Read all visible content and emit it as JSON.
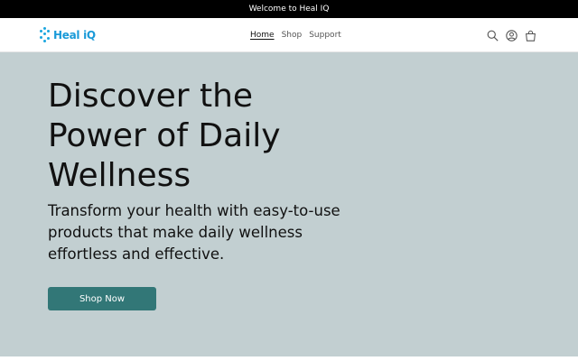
{
  "announcement": {
    "text": "Welcome to Heal IQ"
  },
  "brand": {
    "logo_text": "Heal iQ",
    "color": "#1a9ad8"
  },
  "nav": {
    "items": [
      {
        "label": "Home",
        "active": true
      },
      {
        "label": "Shop",
        "active": false
      },
      {
        "label": "Support",
        "active": false
      }
    ]
  },
  "header_icons": [
    "search-icon",
    "account-icon",
    "cart-icon"
  ],
  "hero": {
    "title": "Discover the Power of Daily Wellness",
    "subtitle": "Transform your health with easy-to-use products that make daily wellness effortless and effective.",
    "cta_label": "Shop Now",
    "background": "#c2cfd1",
    "cta_color": "#327777"
  }
}
